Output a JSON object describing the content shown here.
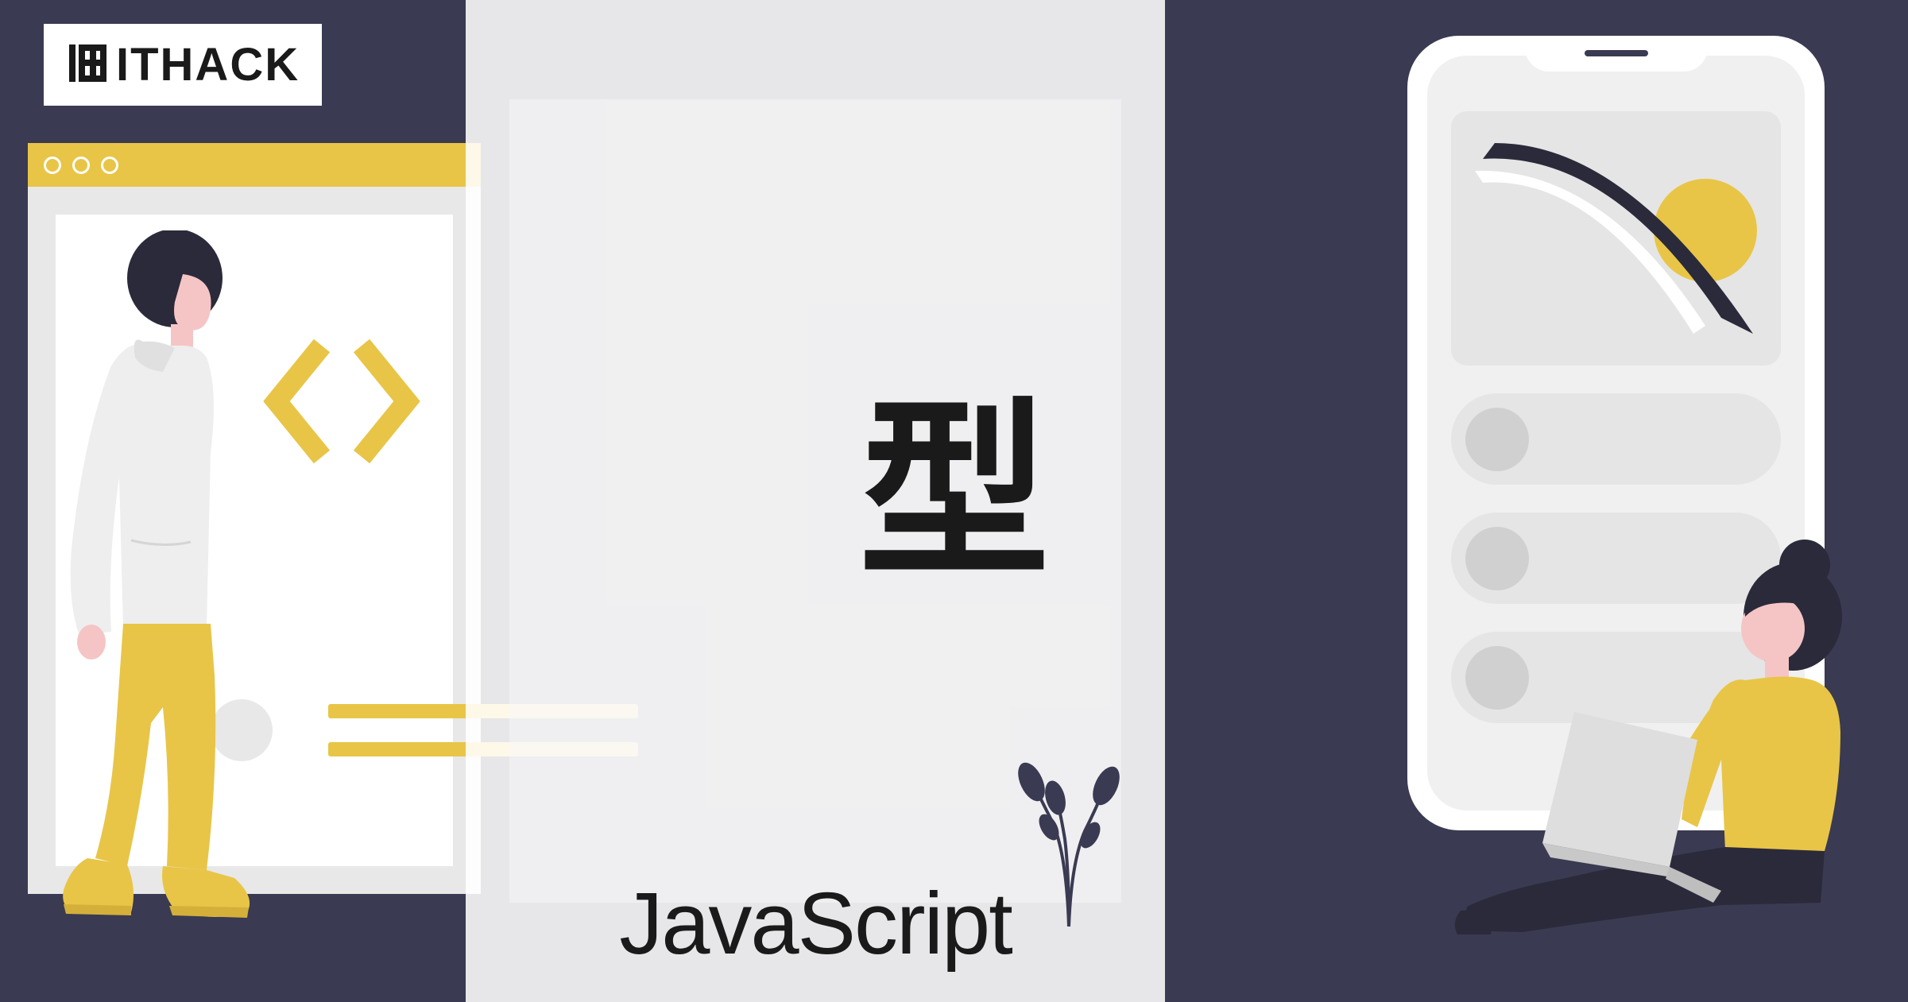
{
  "logo": {
    "text": "ITHACK"
  },
  "main": {
    "title": "型",
    "subtitle": "JavaScript"
  },
  "colors": {
    "background": "#3a3a52",
    "accent": "#e8c547",
    "skin": "#f5c5c5",
    "darkHair": "#2a2a3a"
  }
}
